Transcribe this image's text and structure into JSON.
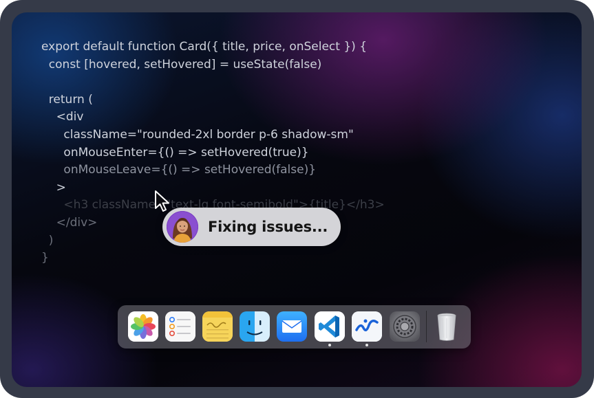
{
  "editor": {
    "lines": [
      "export default function Card({ title, price, onSelect }) {",
      "  const [hovered, setHovered] = useState(false)",
      "",
      "  return (",
      "    <div",
      "      className=\"rounded-2xl border p-6 shadow-sm\"",
      "      onMouseEnter={() => setHovered(true)}",
      "      onMouseLeave={() => setHovered(false)}",
      "    >",
      "      <h3 className=\"text-lg font-semibold\">{title}</h3>",
      "    </div>",
      "  )",
      "}"
    ]
  },
  "status": {
    "text": "Fixing issues..."
  },
  "dock": {
    "items": [
      {
        "name": "Photos",
        "icon": "photos-icon",
        "running": false
      },
      {
        "name": "Reminders",
        "icon": "reminders-icon",
        "running": false
      },
      {
        "name": "Notes",
        "icon": "notes-icon",
        "running": false
      },
      {
        "name": "Finder",
        "icon": "finder-icon",
        "running": false
      },
      {
        "name": "Mail",
        "icon": "mail-icon",
        "running": false
      },
      {
        "name": "Visual Studio Code",
        "icon": "vscode-icon",
        "running": true
      },
      {
        "name": "Windsurf",
        "icon": "windsurf-icon",
        "running": true
      },
      {
        "name": "System Settings",
        "icon": "settings-gear-icon",
        "running": false
      },
      {
        "name": "Trash",
        "icon": "trash-icon",
        "running": false
      }
    ]
  },
  "colors": {
    "bezel": "#353a48",
    "pill": "#d4d4d8",
    "code_text": "#cfd3dc"
  }
}
